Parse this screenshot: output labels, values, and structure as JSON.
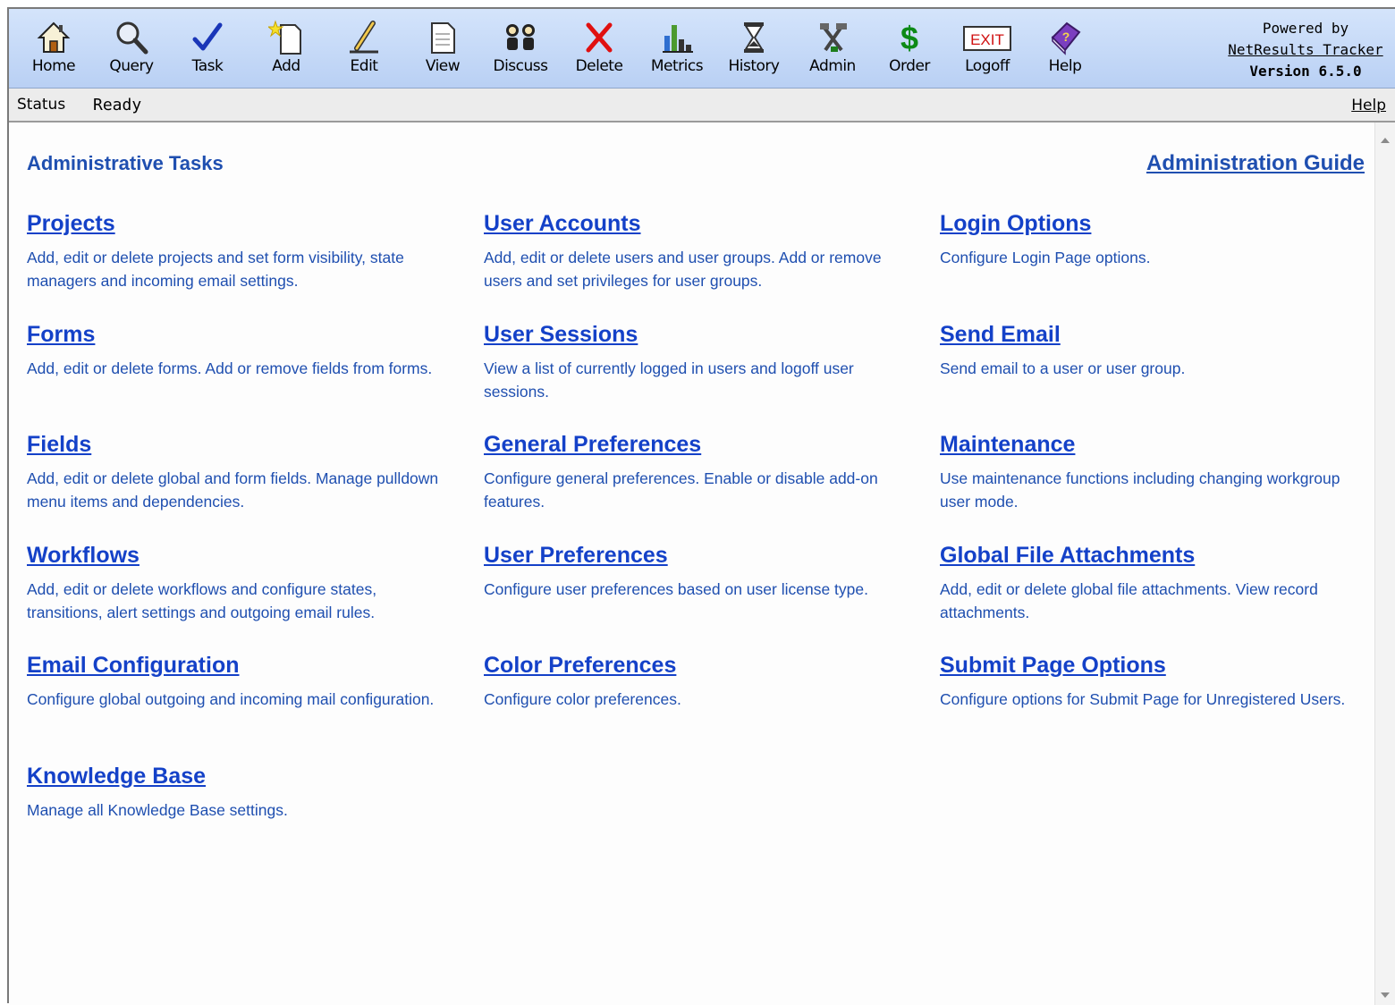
{
  "toolbar": {
    "buttons": [
      {
        "label": "Home",
        "icon": "home-icon"
      },
      {
        "label": "Query",
        "icon": "magnifier-icon"
      },
      {
        "label": "Task",
        "icon": "checkmark-icon"
      },
      {
        "label": "Add",
        "icon": "new-document-icon"
      },
      {
        "label": "Edit",
        "icon": "pencil-icon"
      },
      {
        "label": "View",
        "icon": "document-icon"
      },
      {
        "label": "Discuss",
        "icon": "people-icon"
      },
      {
        "label": "Delete",
        "icon": "red-x-icon"
      },
      {
        "label": "Metrics",
        "icon": "bar-chart-icon"
      },
      {
        "label": "History",
        "icon": "hourglass-icon"
      },
      {
        "label": "Admin",
        "icon": "tools-icon"
      },
      {
        "label": "Order",
        "icon": "dollar-icon"
      },
      {
        "label": "Logoff",
        "icon": "exit-sign-icon"
      },
      {
        "label": "Help",
        "icon": "help-book-icon"
      }
    ],
    "exit_sign_text": "EXIT",
    "dollar_glyph": "$",
    "powered_by": "Powered by",
    "product_link": "NetResults Tracker",
    "version": "Version 6.5.0"
  },
  "status": {
    "key": "Status",
    "value": "Ready",
    "help": "Help"
  },
  "page": {
    "title": "Administrative Tasks",
    "guide_link": "Administration Guide"
  },
  "tasks": {
    "projects": {
      "title": "Projects",
      "desc": "Add, edit or delete projects and set form visibility, state managers and incoming email settings."
    },
    "forms": {
      "title": "Forms",
      "desc": "Add, edit or delete forms. Add or remove fields from forms."
    },
    "fields": {
      "title": "Fields",
      "desc": "Add, edit or delete global and form fields. Manage pulldown menu items and dependencies."
    },
    "workflows": {
      "title": "Workflows",
      "desc": "Add, edit or delete workflows and configure states, transitions, alert settings and outgoing email rules."
    },
    "email_configuration": {
      "title": "Email Configuration",
      "desc": "Configure global outgoing and incoming mail configuration."
    },
    "knowledge_base": {
      "title": "Knowledge Base",
      "desc": "Manage all Knowledge Base settings."
    },
    "user_accounts": {
      "title": "User Accounts",
      "desc": "Add, edit or delete users and user groups. Add or remove users and set privileges for user groups."
    },
    "user_sessions": {
      "title": "User Sessions",
      "desc": "View a list of currently logged in users and logoff user sessions."
    },
    "general_preferences": {
      "title": "General Preferences",
      "desc": "Configure general preferences. Enable or disable add-on features."
    },
    "user_preferences": {
      "title": "User Preferences",
      "desc": "Configure user preferences based on user license type."
    },
    "color_preferences": {
      "title": "Color Preferences",
      "desc": "Configure color preferences."
    },
    "login_options": {
      "title": "Login Options",
      "desc": "Configure Login Page options."
    },
    "send_email": {
      "title": "Send Email",
      "desc": "Send email to a user or user group."
    },
    "maintenance": {
      "title": "Maintenance",
      "desc": "Use maintenance functions including changing workgroup user mode."
    },
    "global_file_attachments": {
      "title": "Global File Attachments",
      "desc": "Add, edit or delete global file attachments. View record attachments."
    },
    "submit_page_options": {
      "title": "Submit Page Options",
      "desc": "Configure options for Submit Page for Unregistered Users."
    }
  },
  "colors": {
    "link": "#1441c8",
    "text": "#1f4fb0",
    "toolbar": "#c6daf8"
  }
}
